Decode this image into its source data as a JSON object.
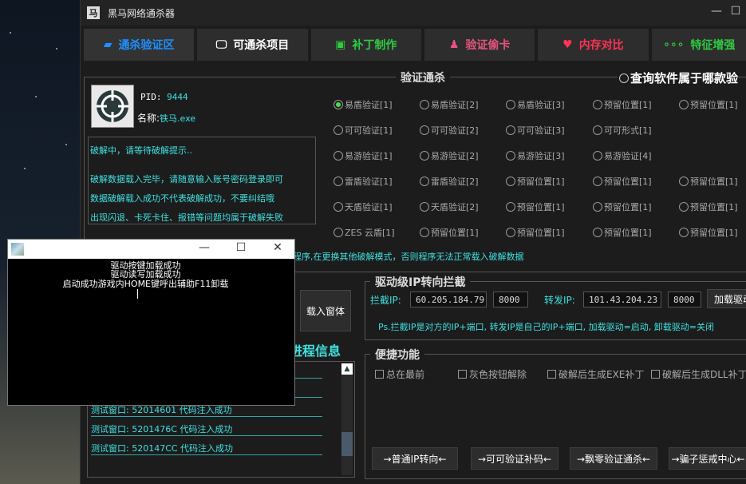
{
  "app": {
    "title": "黑马网络通杀器"
  },
  "tabs": [
    {
      "label": "通杀验证区",
      "icon": "folder-icon",
      "color": "#1e90ff"
    },
    {
      "label": "可通杀项目",
      "icon": "monitor-icon",
      "color": "#ffffff"
    },
    {
      "label": "补丁制作",
      "icon": "chat-icon",
      "color": "#2ecc40"
    },
    {
      "label": "验证偷卡",
      "icon": "users-icon",
      "color": "#e75480"
    },
    {
      "label": "内存对比",
      "icon": "heart-icon",
      "color": "#ff3355"
    },
    {
      "label": "特征增强",
      "icon": "dots-icon",
      "color": "#2ecc40"
    }
  ],
  "verify": {
    "section_title": "验证通杀",
    "query_label": "查询软件属于哪款验",
    "pid_label": "PID:",
    "pid_value": "9444",
    "name_label": "名称:",
    "name_value": "铁马.exe",
    "log": [
      "破解中，请等待破解提示..",
      "破解数据载入完毕，请随意输入账号密码登录即可",
      "数据破解载入成功不代表破解成功，不要纠结哦",
      "出现闪退、卡死卡住、报错等问题均属于破解失败"
    ],
    "radio_rows": [
      [
        "易盾验证[1]",
        "易盾验证[2]",
        "易盾验证[3]",
        "预留位置[1]",
        "预留位置[1]"
      ],
      [
        "可可验证[1]",
        "可可验证[2]",
        "可可验证[3]",
        "可可形式[1]"
      ],
      [
        "易游验证[1]",
        "易游验证[2]",
        "易游验证[3]",
        "易游验证[4]"
      ],
      [
        "雷盾验证[1]",
        "雷盾验证[2]",
        "预留位置[1]",
        "预留位置[1]",
        "预留位置[1]"
      ],
      [
        "天盾验证[1]",
        "天盾验证[2]",
        "预留位置[1]",
        "预留位置[1]",
        "预留位置[1]"
      ],
      [
        "ZES 云盾[1]",
        "预留位置[1]",
        "预留位置[1]",
        "预留位置[1]",
        "预留位置[1]"
      ]
    ],
    "selected_radio": "易盾验证[1]",
    "notice": "闭并重新运行需破解程序,在更换其他破解模式，否则程序无法正常载入破解数据"
  },
  "load_button": "载入窗体",
  "process": {
    "title": "进程信息",
    "items": [
      "测试窗口: 52014601 代码注入成功",
      "测试窗口: 5201476C 代码注入成功",
      "测试窗口: 520147CC 代码注入成功"
    ]
  },
  "ip": {
    "section_title": "驱动级IP转向拦截",
    "intercept_label": "拦截IP:",
    "intercept_ip": "60.205.184.79",
    "intercept_port": "8000",
    "forward_label": "转发IP:",
    "forward_ip": "101.43.204.23",
    "forward_port": "8000",
    "load_driver_button": "加载驱动",
    "note": "Ps.拦截IP是对方的IP+端口, 转发IP是自己的IP+端口, 加载驱动=启动, 卸载驱动=关闭"
  },
  "quick": {
    "section_title": "便捷功能",
    "checks": [
      "总在最前",
      "灰色按钮解除",
      "破解后生成EXE补丁",
      "破解后生成DLL补丁"
    ],
    "buttons": [
      "→普通IP转向←",
      "→可可验证补码←",
      "→飘零验证通杀←",
      "→骗子惩戒中心←"
    ]
  },
  "console": {
    "lines": [
      "驱动按键加载成功",
      "驱动读写加载成功",
      "启动成功游戏内HOME键呼出辅助F11卸载"
    ]
  }
}
